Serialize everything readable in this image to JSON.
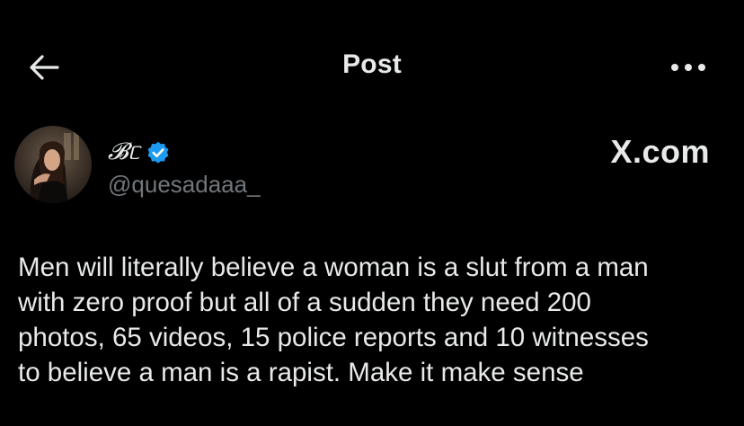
{
  "header": {
    "title": "Post",
    "back_icon": "arrow-left-icon",
    "more_icon": "more-horizontal-icon"
  },
  "author": {
    "display_name": "𝓑ᥴ",
    "verified_color": "#1d9bf0",
    "handle": "@quesadaaa_"
  },
  "watermark": "X.com",
  "tweet": {
    "text": "Men will literally believe a woman is a slut from a man\nwith zero proof but all of a sudden they need 200\nphotos, 65 videos, 15 police reports and 10 witnesses\nto believe a man is a rapist. Make it make sense"
  },
  "colors": {
    "background": "#000000",
    "text": "#e7e9ea",
    "secondary_text": "#71767b",
    "accent": "#1d9bf0"
  }
}
